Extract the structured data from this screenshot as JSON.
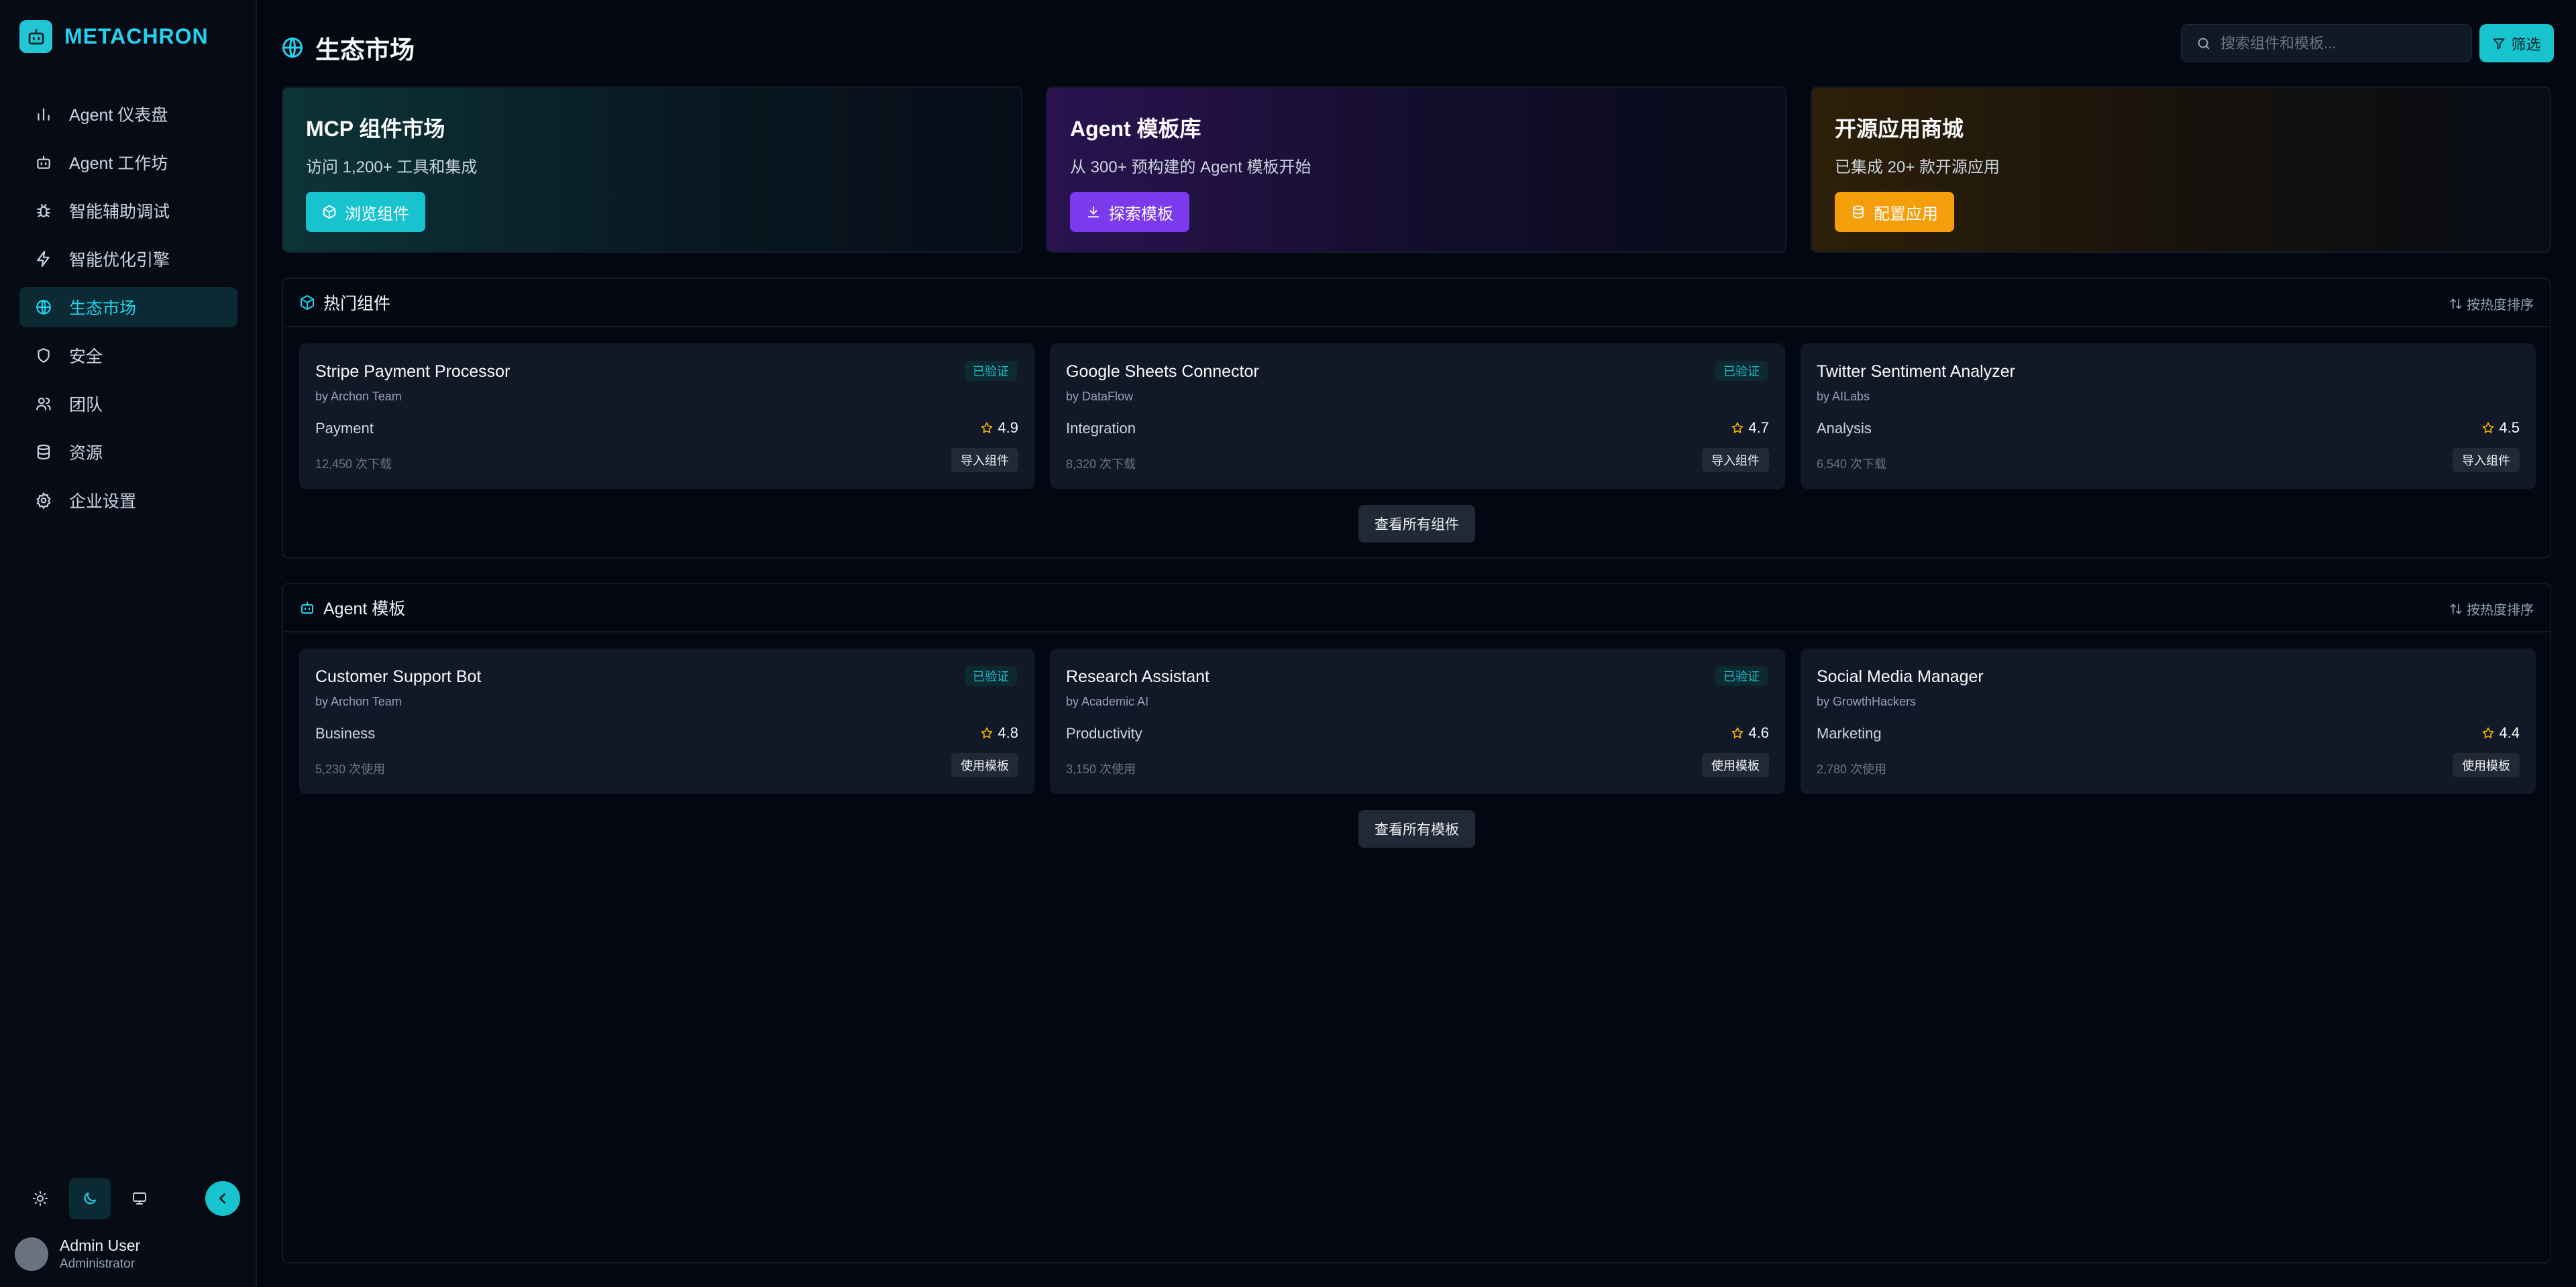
{
  "app": {
    "brand_name": "METACHRON"
  },
  "sidebar": {
    "items": [
      {
        "label": "Agent 仪表盘",
        "icon": "bar-chart-icon"
      },
      {
        "label": "Agent 工作坊",
        "icon": "bot-icon"
      },
      {
        "label": "智能辅助调试",
        "icon": "bug-icon"
      },
      {
        "label": "智能优化引擎",
        "icon": "zap-icon"
      },
      {
        "label": "生态市场",
        "icon": "globe-icon",
        "active": true
      },
      {
        "label": "安全",
        "icon": "shield-icon"
      },
      {
        "label": "团队",
        "icon": "users-icon"
      },
      {
        "label": "资源",
        "icon": "database-icon"
      },
      {
        "label": "企业设置",
        "icon": "gear-icon"
      }
    ],
    "theme_modes": [
      "light",
      "dark",
      "system"
    ],
    "active_theme": "dark",
    "user": {
      "name": "Admin User",
      "role": "Administrator"
    }
  },
  "header": {
    "title": "生态市场",
    "search_placeholder": "搜索组件和模板...",
    "filter_label": "筛选"
  },
  "promos": [
    {
      "title": "MCP 组件市场",
      "subtitle": "访问 1,200+ 工具和集成",
      "button": "浏览组件",
      "accent": "#17c3cf"
    },
    {
      "title": "Agent 模板库",
      "subtitle": "从 300+ 预构建的 Agent 模板开始",
      "button": "探索模板",
      "accent": "#7c3aed"
    },
    {
      "title": "开源应用商城",
      "subtitle": "已集成 20+ 款开源应用",
      "button": "配置应用",
      "accent": "#f59e0b"
    }
  ],
  "components": {
    "title": "热门组件",
    "sort_label": "按热度排序",
    "more_label": "查看所有组件",
    "items": [
      {
        "name": "Stripe Payment Processor",
        "author": "by Archon Team",
        "badge": "已验证",
        "category": "Payment",
        "rating": "4.9",
        "stat": "12,450 次下载",
        "action": "导入组件"
      },
      {
        "name": "Google Sheets Connector",
        "author": "by DataFlow",
        "badge": "已验证",
        "category": "Integration",
        "rating": "4.7",
        "stat": "8,320 次下载",
        "action": "导入组件"
      },
      {
        "name": "Twitter Sentiment Analyzer",
        "author": "by AILabs",
        "badge": "",
        "category": "Analysis",
        "rating": "4.5",
        "stat": "6,540 次下载",
        "action": "导入组件"
      }
    ]
  },
  "templates": {
    "title": "Agent 模板",
    "sort_label": "按热度排序",
    "more_label": "查看所有模板",
    "items": [
      {
        "name": "Customer Support Bot",
        "author": "by Archon Team",
        "badge": "已验证",
        "category": "Business",
        "rating": "4.8",
        "stat": "5,230 次使用",
        "action": "使用模板"
      },
      {
        "name": "Research Assistant",
        "author": "by Academic AI",
        "badge": "已验证",
        "category": "Productivity",
        "rating": "4.6",
        "stat": "3,150 次使用",
        "action": "使用模板"
      },
      {
        "name": "Social Media Manager",
        "author": "by GrowthHackers",
        "badge": "",
        "category": "Marketing",
        "rating": "4.4",
        "stat": "2,780 次使用",
        "action": "使用模板"
      }
    ]
  }
}
